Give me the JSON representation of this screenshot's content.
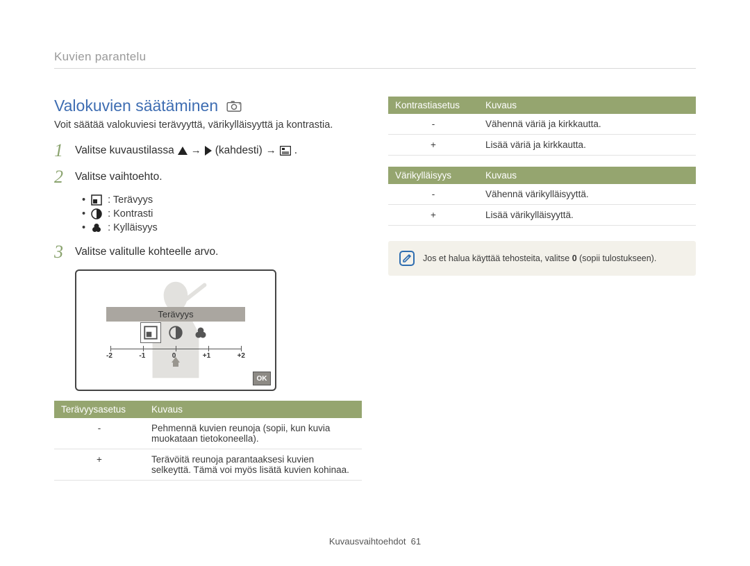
{
  "breadcrumb": "Kuvien parantelu",
  "title": "Valokuvien säätäminen",
  "intro": "Voit säätää valokuviesi terävyyttä, värikylläisyyttä ja kontrastia.",
  "steps": {
    "s1": {
      "num": "1",
      "lead": "Valitse kuvaustilassa",
      "paren": "(kahdesti)",
      "end": "."
    },
    "s2": {
      "num": "2",
      "text": "Valitse vaihtoehto."
    },
    "s3": {
      "num": "3",
      "text": "Valitse valitulle kohteelle arvo."
    }
  },
  "bullets": {
    "b1": ": Terävyys",
    "b2": ": Kontrasti",
    "b3": ": Kylläisyys"
  },
  "preview": {
    "label": "Terävyys",
    "scale": {
      "m2": "-2",
      "m1": "-1",
      "z": "0",
      "p1": "+1",
      "p2": "+2"
    },
    "ok": "OK"
  },
  "tables": {
    "sharp": {
      "h1": "Terävyysasetus",
      "h2": "Kuvaus",
      "rows": [
        {
          "k": "-",
          "v": "Pehmennä kuvien reunoja (sopii, kun kuvia muokataan tietokoneella)."
        },
        {
          "k": "+",
          "v": "Terävöitä reunoja parantaaksesi kuvien selkeyttä. Tämä voi myös lisätä kuvien kohinaa."
        }
      ]
    },
    "contrast": {
      "h1": "Kontrastiasetus",
      "h2": "Kuvaus",
      "rows": [
        {
          "k": "-",
          "v": "Vähennä väriä ja kirkkautta."
        },
        {
          "k": "+",
          "v": "Lisää väriä ja kirkkautta."
        }
      ]
    },
    "sat": {
      "h1": "Värikylläisyys",
      "h2": "Kuvaus",
      "rows": [
        {
          "k": "-",
          "v": "Vähennä värikylläisyyttä."
        },
        {
          "k": "+",
          "v": "Lisää värikylläisyyttä."
        }
      ]
    }
  },
  "note": {
    "pre": "Jos et halua käyttää tehosteita, valitse ",
    "bold": "0",
    "post": " (sopii tulostukseen)."
  },
  "footer": {
    "label": "Kuvausvaihtoehdot",
    "page": "61"
  }
}
